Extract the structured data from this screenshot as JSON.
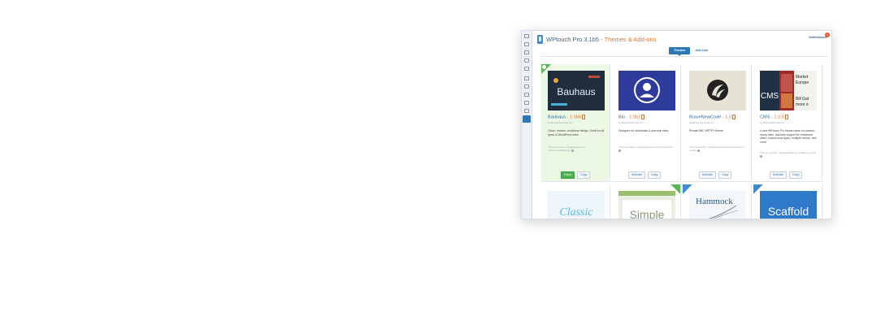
{
  "app": {
    "title": "WPtouch Pro 3.1b5",
    "separator": " - ",
    "subtitle": "Themes & Add-ons",
    "notifications_label": "Notifications",
    "notifications_count": "4"
  },
  "tabs": [
    {
      "label": "Themes",
      "active": true
    },
    {
      "label": "Add-Ons",
      "active": false
    }
  ],
  "themes": [
    {
      "name": "Bauhaus",
      "version": " - 1.0b6",
      "by": "by BraveNewCode Inc.",
      "description": "Clean, modern, functional design. Great for all types of WordPress sites.",
      "location": "Theme location: /plugins/wptouch-pro/themes/bauhaus",
      "primary_button": "Setup",
      "secondary_button": "Copy",
      "thumb_text": "Bauhaus",
      "active": true
    },
    {
      "name": "Bio",
      "version": " - 1.0b1",
      "by": "by BraveNewCode Inc.",
      "description": "Designed for individuals & personal sites.",
      "location": "Theme location: /plugins/wptouch-pro/themes/bio",
      "primary_button": "Activate",
      "secondary_button": "Copy",
      "active": false
    },
    {
      "name": "BraveNewCode",
      "version": " - 1.0",
      "by": "by BraveNewCode Inc.",
      "description": "Private BNC WPTP3 theme.",
      "location": "Theme location: /plugins/wptouch-pro/themes/bnc-mobile",
      "primary_button": "Activate",
      "secondary_button": "Copy",
      "active": false
    },
    {
      "name": "CMS",
      "version": " - 1.0.5",
      "by": "by BraveNewCode Inc.",
      "description": "A new WPtouch Pro theme made for content-heavy sites. Includes support for a featured slider, custom post types, multiple menus, and more.",
      "location": "Theme location: /plugins/wptouch-pro/themes/cms",
      "primary_button": "Activate",
      "secondary_button": "Copy",
      "thumb_text": "CMS",
      "thumb_side_lines": [
        "Market",
        "Europe",
        "Bill Gat",
        "more o"
      ],
      "active": false
    }
  ],
  "themes_row2": [
    {
      "thumb_text": "Classic"
    },
    {
      "thumb_text": "Simple"
    },
    {
      "thumb_text": "Hammock"
    },
    {
      "thumb_text": "Scaffold"
    }
  ],
  "colors": {
    "accent_blue": "#2d79b8",
    "version_orange": "#e0732e",
    "active_green": "#4caf50",
    "bauhaus_bg": "#203040",
    "bio_bg": "#2e3b9a"
  },
  "icons": {
    "rail": [
      "dashboard-icon",
      "pencil-icon",
      "layers-icon",
      "page-icon",
      "chat-icon",
      "image-icon",
      "wrench-icon",
      "copy-icon",
      "list-icon",
      "grid-icon",
      "themes-icon"
    ]
  }
}
